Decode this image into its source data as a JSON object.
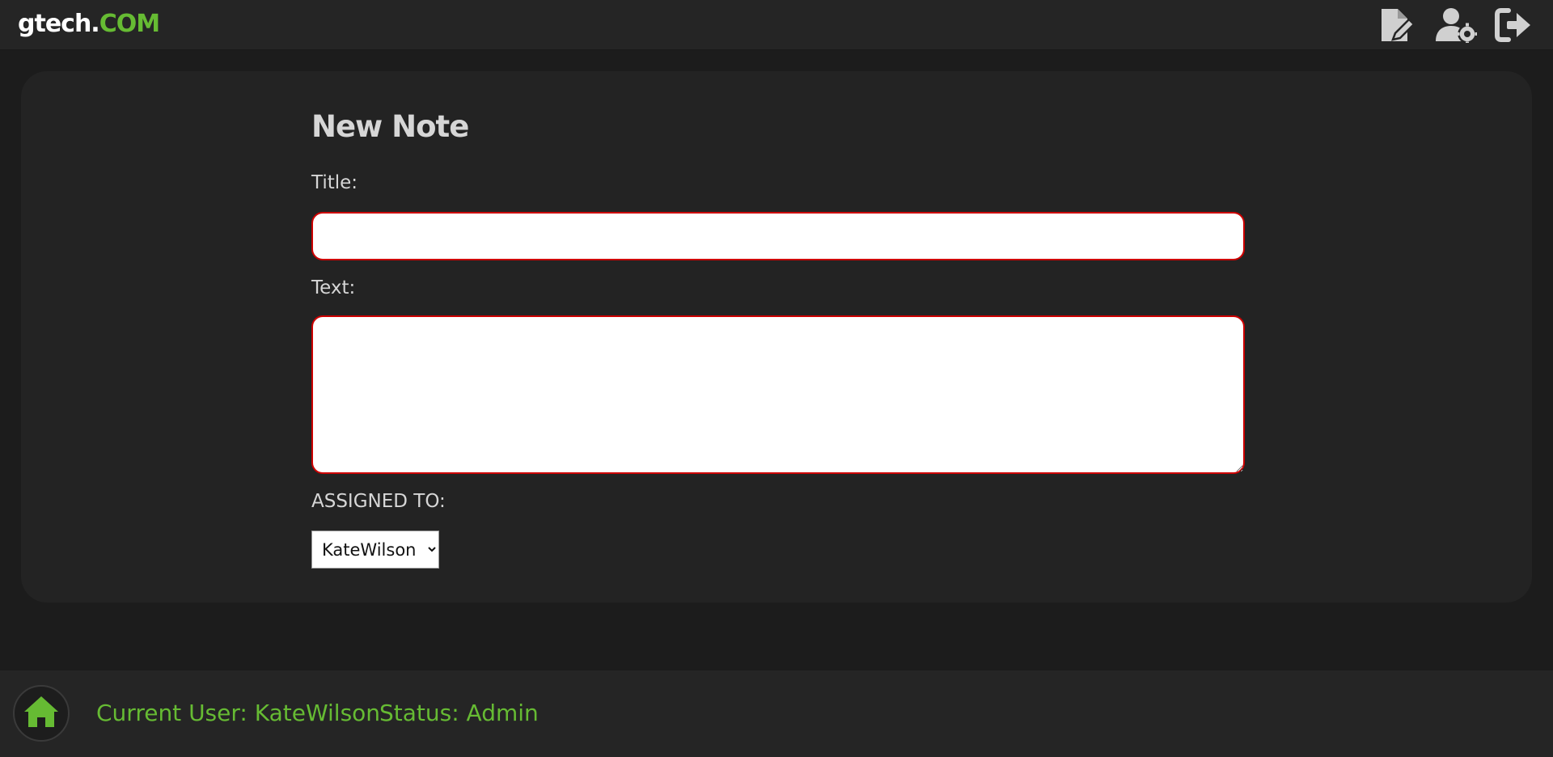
{
  "header": {
    "logo_main": "gtech.",
    "logo_tld": "COM",
    "icons": [
      "new-note-icon",
      "user-settings-icon",
      "logout-icon"
    ]
  },
  "form": {
    "heading": "New Note",
    "title_label": "Title:",
    "title_value": "",
    "text_label": "Text:",
    "text_value": "",
    "assigned_label": "ASSIGNED TO:",
    "assigned_selected": "KateWilson"
  },
  "footer": {
    "current_user": "Current User: KateWilson",
    "status": "Status: Admin",
    "home_icon": "home-icon"
  },
  "colors": {
    "accent_green": "#66bb33",
    "input_border_invalid": "#cc0000",
    "background": "#1c1c1c",
    "panel": "#232323"
  }
}
